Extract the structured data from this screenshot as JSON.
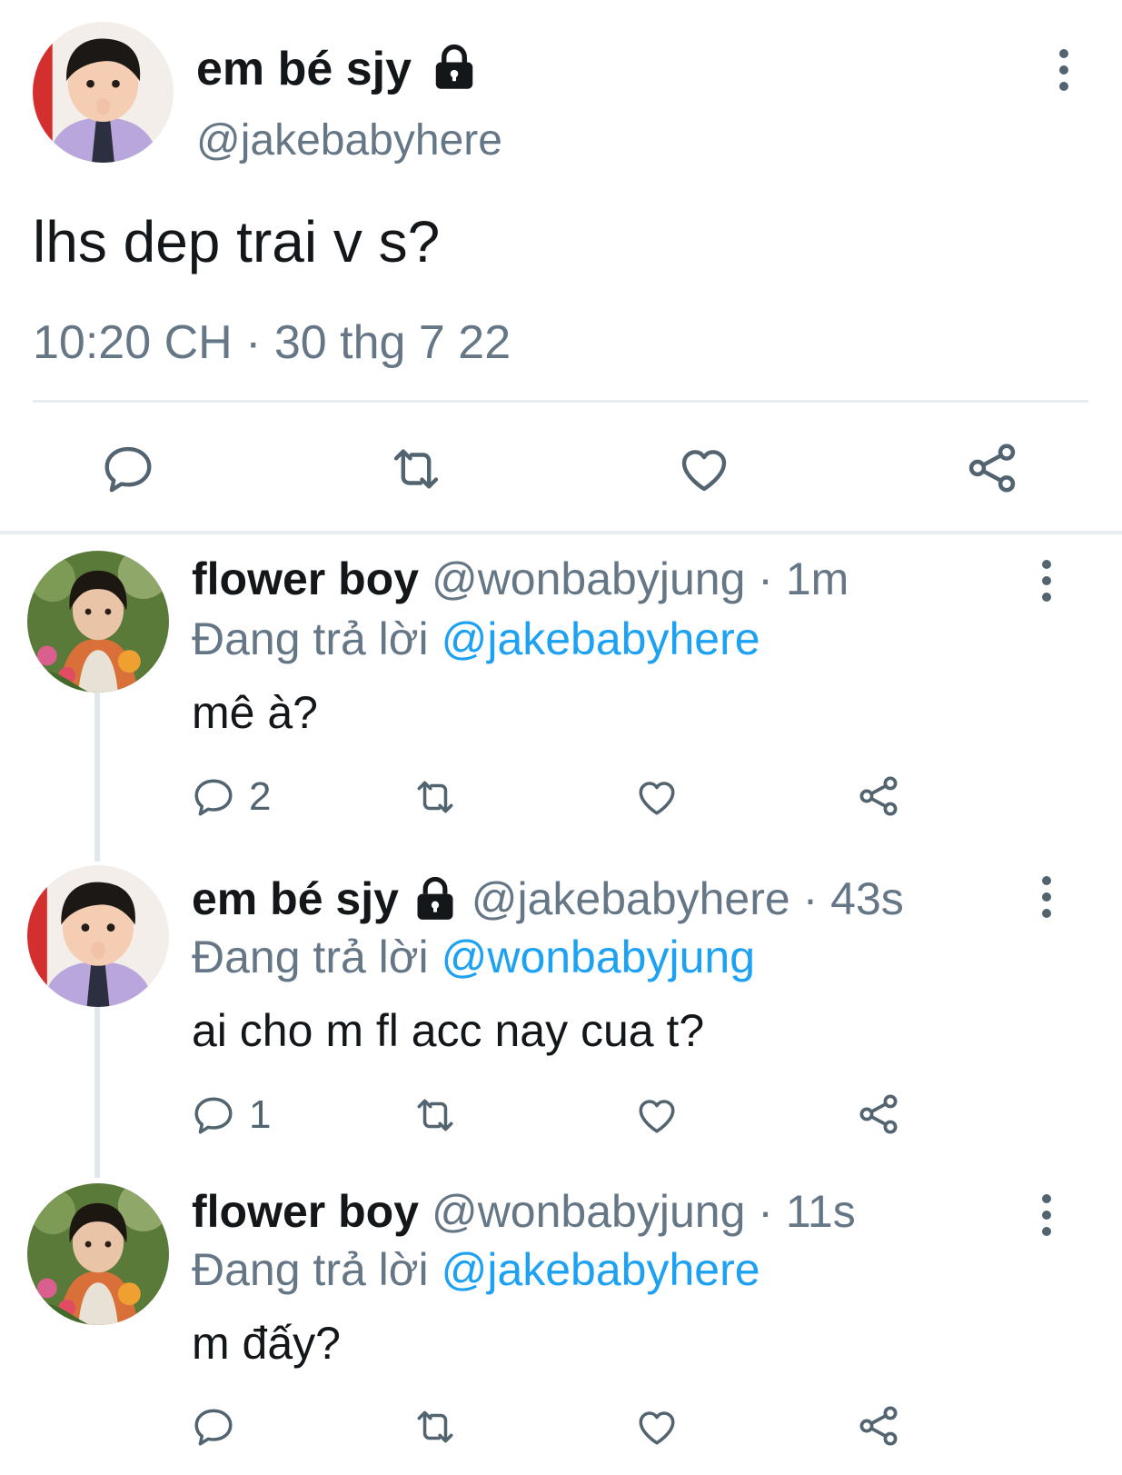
{
  "main_tweet": {
    "display_name": "em bé sjy",
    "handle": "@jakebabyhere",
    "text": "lhs dep trai v s?",
    "timestamp": "10:20 CH · 30 thg 7 22",
    "avatar": "baby-boy-avatar"
  },
  "replies": [
    {
      "display_name": "flower boy",
      "handle": "@wonbabyjung",
      "time": "· 1m",
      "replying_prefix": "Đang trả lời",
      "replying_to": "@jakebabyhere",
      "text": "mê à?",
      "reply_count": "2",
      "avatar": "flower-boy-avatar"
    },
    {
      "display_name": "em bé sjy",
      "handle": "@jakebabyhere",
      "time": "· 43s",
      "replying_prefix": "Đang trả lời",
      "replying_to": "@wonbabyjung",
      "text": "ai cho m fl acc nay cua t?",
      "reply_count": "1",
      "avatar": "baby-boy-avatar"
    },
    {
      "display_name": "flower boy",
      "handle": "@wonbabyjung",
      "time": "· 11s",
      "replying_prefix": "Đang trả lời",
      "replying_to": "@jakebabyhere",
      "text": "m đấy?",
      "reply_count": "",
      "avatar": "flower-boy-avatar"
    }
  ],
  "colors": {
    "text": "#14171a",
    "secondary": "#657786",
    "link": "#1da1f2",
    "icon": "#536471",
    "divider": "#e6ecf0"
  }
}
